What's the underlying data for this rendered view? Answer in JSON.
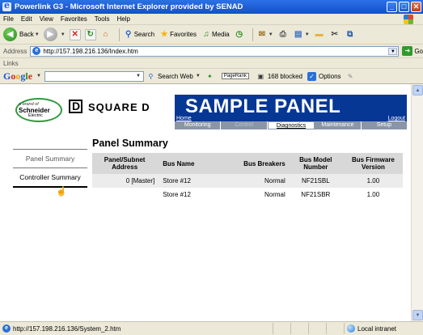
{
  "window": {
    "title": "Powerlink G3 - Microsoft Internet Explorer provided by SENAD",
    "minimize": "_",
    "maximize": "□"
  },
  "menu": [
    "File",
    "Edit",
    "View",
    "Favorites",
    "Tools",
    "Help"
  ],
  "toolbar": {
    "back": "Back",
    "search": "Search",
    "favorites": "Favorites",
    "media": "Media"
  },
  "address": {
    "label": "Address",
    "url": "http://157.198.216.136/Index.htm",
    "go": "Go"
  },
  "links": {
    "label": "Links"
  },
  "google_bar": {
    "search_web": "Search Web",
    "pagerank": "PageRank",
    "blocked": "168 blocked",
    "options": "Options"
  },
  "brand": {
    "brand_of": "a brand of",
    "schneider": "Schneider",
    "electric": "Electric",
    "square_d": "SQUARE D"
  },
  "banner": {
    "title": "SAMPLE PANEL",
    "home": "Home",
    "logout": "Logout"
  },
  "nav": [
    {
      "label": "Monitoring",
      "state": "normal"
    },
    {
      "label": "Control",
      "state": "disabled"
    },
    {
      "label": "Diagnostics",
      "state": "active"
    },
    {
      "label": "Maintenance",
      "state": "normal"
    },
    {
      "label": "Setup",
      "state": "normal"
    }
  ],
  "leftnav": [
    {
      "label": "Panel Summary"
    },
    {
      "label": "Controller Summary"
    }
  ],
  "panel_summary": {
    "title": "Panel Summary",
    "headers": [
      "Panel/Subnet Address",
      "Bus Name",
      "Bus Breakers",
      "Bus Model Number",
      "Bus Firmware Version"
    ],
    "rows": [
      [
        "0 [Master]",
        "Store #12",
        "Normal",
        "NF21SBL",
        "1.00"
      ],
      [
        "",
        "Store #12",
        "Normal",
        "NF21SBR",
        "1.00"
      ]
    ]
  },
  "status": {
    "text": "http://157.198.216.136/System_2.htm",
    "zone": "Local intranet"
  }
}
